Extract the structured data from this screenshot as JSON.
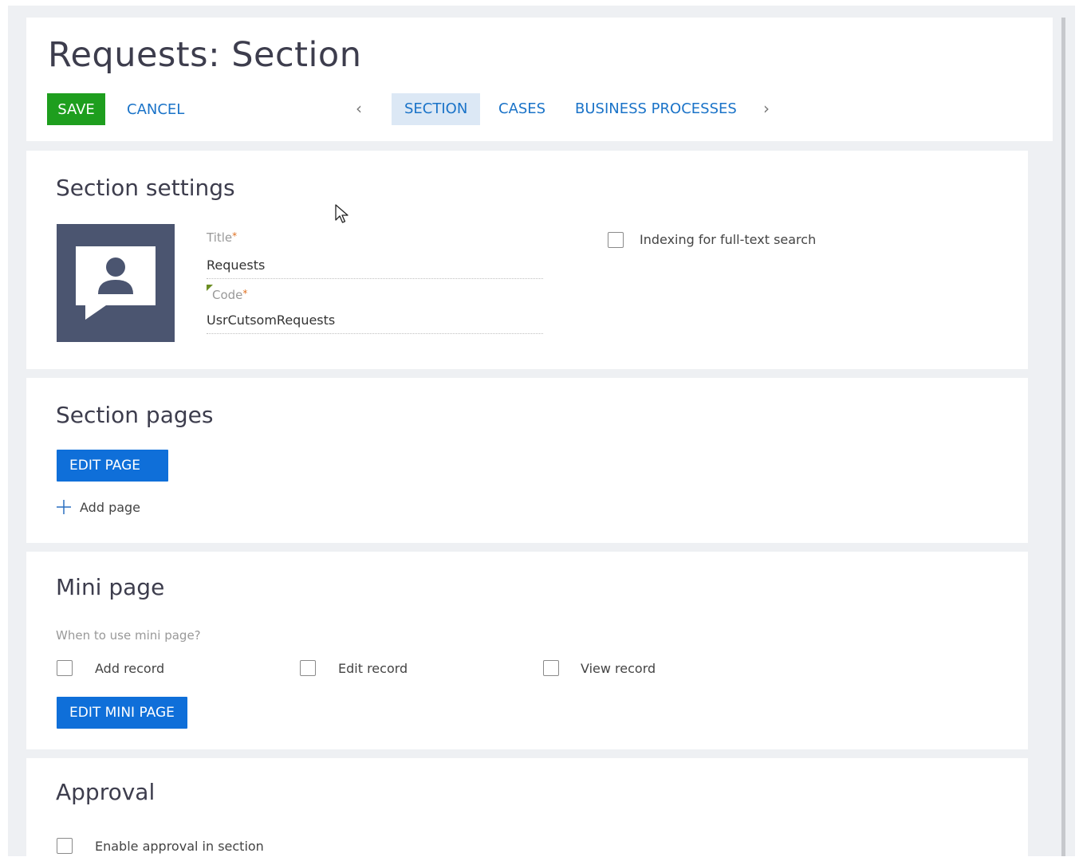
{
  "header": {
    "title": "Requests: Section",
    "save_label": "SAVE",
    "cancel_label": "CANCEL",
    "tabs": [
      {
        "label": "SECTION",
        "active": true
      },
      {
        "label": "CASES",
        "active": false
      },
      {
        "label": "BUSINESS PROCESSES",
        "active": false
      }
    ]
  },
  "settings": {
    "title": "Section settings",
    "icon": "person-speech-bubble-icon",
    "title_label": "Title",
    "title_value": "Requests",
    "code_label": "Code",
    "code_value": "UsrCutsomRequests",
    "required_mark": "*",
    "indexing_label": "Indexing for full-text search",
    "indexing_checked": false
  },
  "pages": {
    "title": "Section pages",
    "edit_page_label": "EDIT PAGE",
    "add_page_label": "Add page"
  },
  "mini_page": {
    "title": "Mini page",
    "question": "When to use mini page?",
    "options": [
      {
        "label": "Add record",
        "checked": false
      },
      {
        "label": "Edit record",
        "checked": false
      },
      {
        "label": "View record",
        "checked": false
      }
    ],
    "edit_label": "EDIT MINI PAGE"
  },
  "approval": {
    "title": "Approval",
    "enable_label": "Enable approval in section",
    "enable_checked": false
  },
  "colors": {
    "save": "#1e9e1e",
    "link": "#1a73c8",
    "primary": "#0f6fd9",
    "icon_bg": "#4b5570",
    "active_tab": "#dce8f5"
  }
}
